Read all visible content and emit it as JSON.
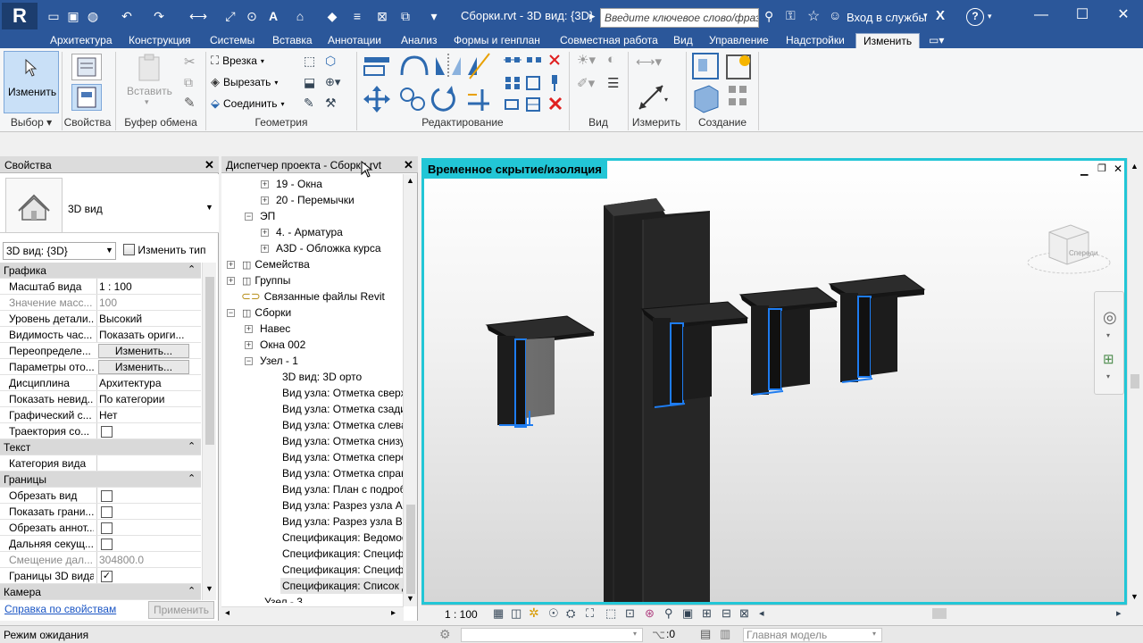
{
  "app": {
    "logo": "R",
    "title": "Сборки.rvt - 3D вид: {3D}",
    "search_placeholder": "Введите ключевое слово/фразу",
    "signin": "Вход в службы",
    "help": "?"
  },
  "tabs": [
    "Архитектура",
    "Конструкция",
    "Системы",
    "Вставка",
    "Аннотации",
    "Анализ",
    "Формы и генплан",
    "Совместная работа",
    "Вид",
    "Управление",
    "Надстройки",
    "Изменить"
  ],
  "ribbon": {
    "modify_label": "Изменить",
    "paste_label": "Вставить",
    "cut_join": "Врезка",
    "cut": "Вырезать",
    "join": "Соединить",
    "panels": {
      "select": "Выбор",
      "properties": "Свойства",
      "clipboard": "Буфер обмена",
      "geometry": "Геометрия",
      "modify": "Редактирование",
      "view": "Вид",
      "measure": "Измерить",
      "create": "Создание"
    }
  },
  "properties": {
    "title": "Свойства",
    "type_name": "3D вид",
    "view_selector": "3D вид: {3D}",
    "edit_type": "Изменить тип",
    "sections": {
      "graphics": "Графика",
      "text": "Текст",
      "extents": "Границы",
      "camera": "Камера"
    },
    "rows": {
      "scale_k": "Масштаб вида",
      "scale_v": "1 : 100",
      "scalev_k": "Значение масс...",
      "scalev_v": "100",
      "detail_k": "Уровень детали...",
      "detail_v": "Высокий",
      "partvis_k": "Видимость час...",
      "partvis_v": "Показать ориги...",
      "overrides_k": "Переопределе...",
      "overrides_v": "Изменить...",
      "display_k": "Параметры ото...",
      "display_v": "Изменить...",
      "discipline_k": "Дисциплина",
      "discipline_v": "Архитектура",
      "hidden_k": "Показать невид...",
      "hidden_v": "По категории",
      "graphic_k": "Графический с...",
      "graphic_v": "Нет",
      "sun_k": "Траектория со...",
      "category_k": "Категория вида",
      "crop_k": "Обрезать вид",
      "cropshow_k": "Показать грани...",
      "annot_k": "Обрезать аннот...",
      "farclip_k": "Дальняя секущ...",
      "faroff_k": "Смещение дал...",
      "faroff_v": "304800.0",
      "box_k": "Границы 3D вида"
    },
    "help_link": "Справка по свойствам",
    "apply": "Применить"
  },
  "browser": {
    "title": "Диспетчер проекта - Сборки.rvt",
    "items": [
      "19 - Окна",
      "20 - Перемычки",
      "ЭП",
      "4. - Арматура",
      "А3D - Обложка курса",
      "Семейства",
      "Группы",
      "Связанные файлы Revit",
      "Сборки",
      "Навес",
      "Окна 002",
      "Узел - 1",
      "3D вид: 3D орто",
      "Вид узла: Отметка сверху",
      "Вид узла: Отметка сзади",
      "Вид узла: Отметка слева",
      "Вид узла: Отметка снизу",
      "Вид узла: Отметка спереди",
      "Вид узла: Отметка справа",
      "Вид узла: План с подробн",
      "Вид узла: Разрез узла А",
      "Вид узла: Разрез узла В",
      "Спецификация: Ведомость",
      "Спецификация: Специф",
      "Спецификация: Специф",
      "Спецификация: Список д",
      "Узел - 3"
    ]
  },
  "viewport": {
    "banner": "Временное скрытие/изоляция",
    "viewcube_face": "Спереди",
    "scale": "1 : 100"
  },
  "status": {
    "text": "Режим ожидания",
    "zero": ":0",
    "model": "Главная модель"
  },
  "colors": {
    "titlebar": "#2b579a",
    "highlight": "#22c6d6",
    "steel_edge": "#1e7cf0"
  }
}
